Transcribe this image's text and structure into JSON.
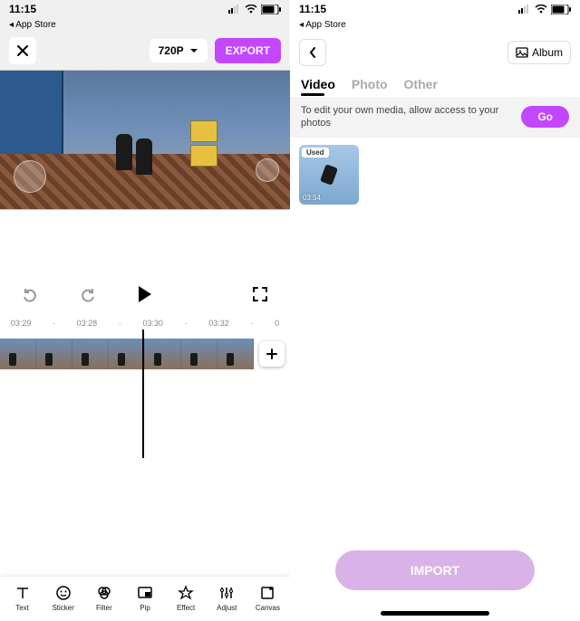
{
  "statusbar": {
    "time": "11:15"
  },
  "backlink": {
    "label": "App Store"
  },
  "left": {
    "resolution": "720P",
    "export": "EXPORT",
    "ruler": [
      "03:29",
      "·",
      "03:28",
      "·",
      "03:30",
      "·",
      "03:32",
      "·",
      "0"
    ],
    "toolbar": [
      {
        "id": "text",
        "label": "Text"
      },
      {
        "id": "sticker",
        "label": "Sticker"
      },
      {
        "id": "filter",
        "label": "Filter"
      },
      {
        "id": "pip",
        "label": "Pip"
      },
      {
        "id": "effect",
        "label": "Effect"
      },
      {
        "id": "adjust",
        "label": "Adjust"
      },
      {
        "id": "canvas",
        "label": "Canvas"
      }
    ]
  },
  "right": {
    "album": "Album",
    "tabs": {
      "video": "Video",
      "photo": "Photo",
      "other": "Other"
    },
    "permission": "To edit your own media, allow access to your photos",
    "go": "Go",
    "media": {
      "used": "Used",
      "duration": "03:54"
    },
    "import": "IMPORT"
  }
}
